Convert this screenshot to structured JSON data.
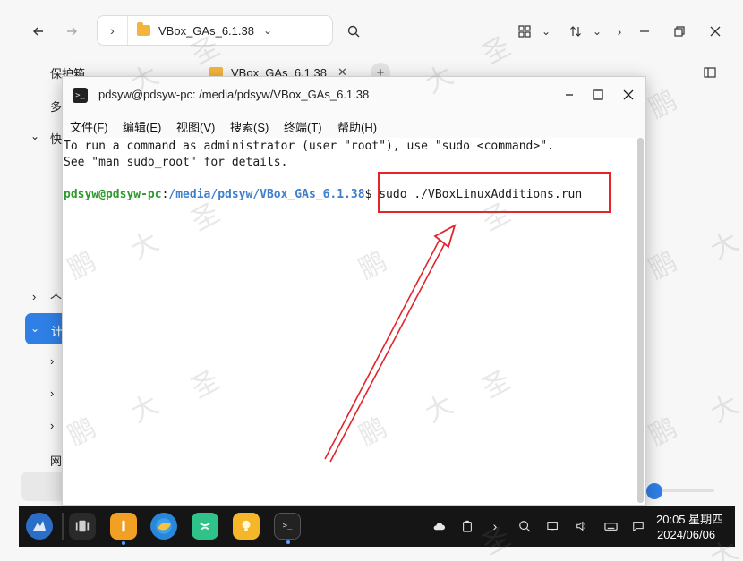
{
  "file_manager": {
    "path_label": "VBox_GAs_6.1.38",
    "tab_label": "VBox_GAs_6.1.38",
    "sidebar": {
      "vault": "保护箱",
      "item_multi": "多",
      "item_quick": "快",
      "item_personal": "个",
      "item_computer": "计",
      "item_network": "网"
    },
    "icons": {
      "back": "arrow-left-icon",
      "forward": "arrow-right-icon",
      "search": "search-icon",
      "grid_view": "grid-view-icon",
      "sort": "sort-icon",
      "sidebar_toggle": "sidebar-toggle-icon"
    }
  },
  "terminal": {
    "title": "pdsyw@pdsyw-pc: /media/pdsyw/VBox_GAs_6.1.38",
    "menu": [
      "文件(F)",
      "编辑(E)",
      "视图(V)",
      "搜索(S)",
      "终端(T)",
      "帮助(H)"
    ],
    "lines": [
      "To run a command as administrator (user \"root\"), use \"sudo <command>\".",
      "See \"man sudo_root\" for details."
    ],
    "prompt_user": "pdsyw@pdsyw-pc",
    "prompt_sep": ":",
    "prompt_path": "/media/pdsyw/VBox_GAs_6.1.38",
    "prompt_symbol": "$",
    "command": " sudo ./VBoxLinuxAdditions.run"
  },
  "taskbar": {
    "time": "20:05 星期四",
    "date": "2024/06/06"
  },
  "watermark": {
    "chars": [
      "鹏",
      "大",
      "圣"
    ]
  },
  "colors": {
    "annotation_red": "#e0262c",
    "accent_blue": "#2f7fe6",
    "prompt_green": "#2e9a2e",
    "prompt_blue": "#3f7fcc"
  }
}
